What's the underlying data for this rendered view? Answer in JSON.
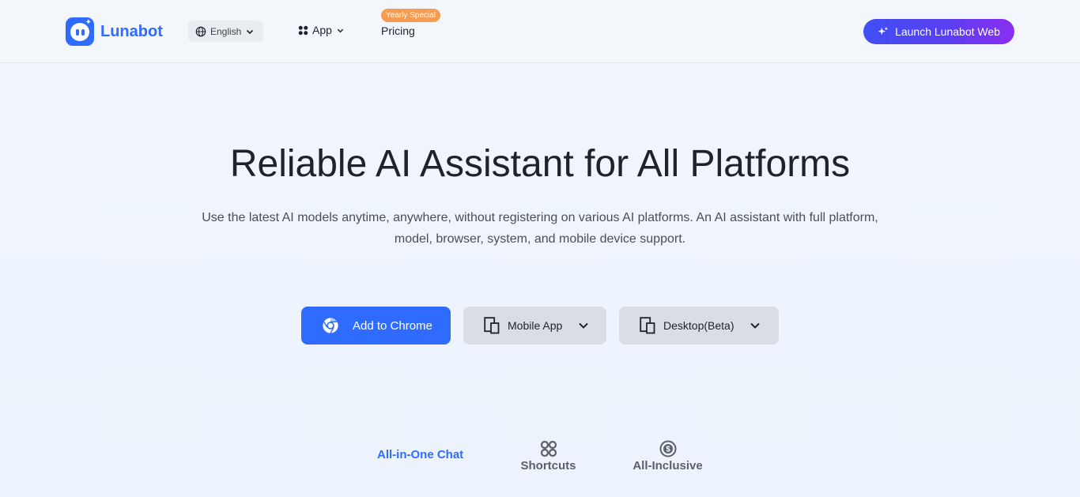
{
  "header": {
    "brand": "Lunabot",
    "language": "English",
    "nav_app": "App",
    "nav_pricing": "Pricing",
    "pricing_badge": "Yearly Special",
    "launch_button": "Launch Lunabot Web"
  },
  "hero": {
    "title": "Reliable AI Assistant for All Platforms",
    "subtitle": "Use the latest AI models anytime, anywhere, without registering on various AI platforms. An AI assistant with full platform, model, browser, system, and mobile device support."
  },
  "actions": {
    "add_to_chrome": "Add to Chrome",
    "mobile_app": "Mobile App",
    "desktop": "Desktop(Beta)"
  },
  "feature_tabs": [
    {
      "label": "All-in-One Chat",
      "active": true
    },
    {
      "label": "Shortcuts",
      "active": false,
      "icon": "grid-icon"
    },
    {
      "label": "All-Inclusive",
      "active": false,
      "icon": "dollar-icon"
    }
  ],
  "colors": {
    "brand": "#2f6bff",
    "badge": "#f79b50",
    "launch_gradient_start": "#3f4ff4",
    "launch_gradient_end": "#8a2ef0"
  }
}
